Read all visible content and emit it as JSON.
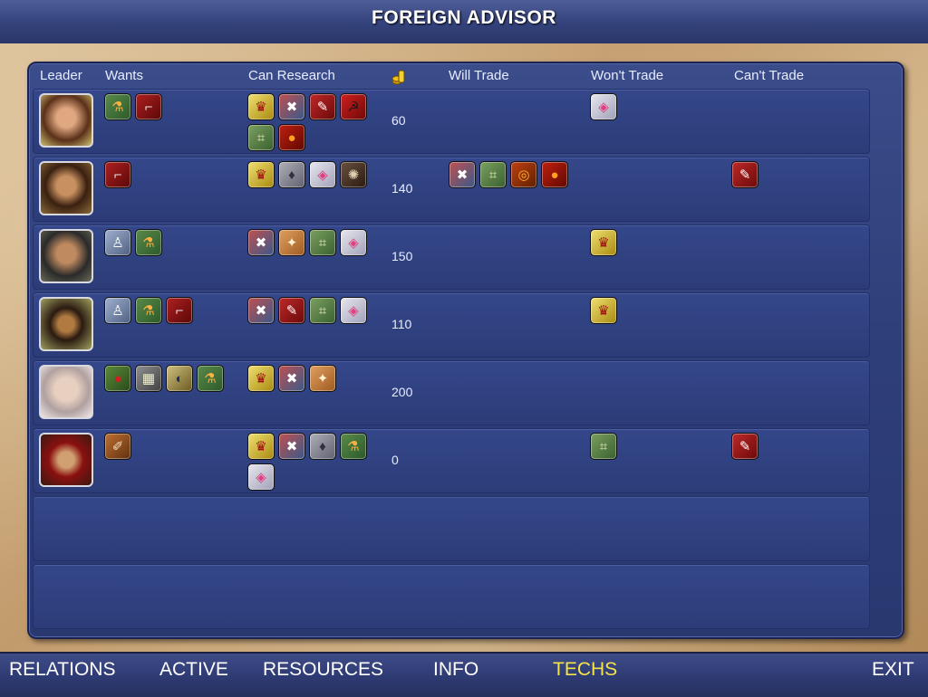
{
  "window": {
    "title": "FOREIGN ADVISOR"
  },
  "columns": {
    "leader": "Leader",
    "wants": "Wants",
    "can_research": "Can Research",
    "will_trade": "Will Trade",
    "wont_trade": "Won't Trade",
    "cant_trade": "Can't Trade"
  },
  "rows": [
    {
      "leader": "leader-1",
      "gold": "60",
      "wants": [
        "chemistry-icon",
        "rifling-icon"
      ],
      "can_research": [
        "monarchy-icon",
        "nationalism-icon",
        "education-icon",
        "communism-icon",
        "cartography-icon",
        "gunpowder-icon"
      ],
      "will_trade": [],
      "wont_trade": [
        "optics-icon"
      ],
      "cant_trade": []
    },
    {
      "leader": "leader-2",
      "gold": "140",
      "wants": [
        "rifling-icon"
      ],
      "can_research": [
        "monarchy-icon",
        "economics-icon",
        "optics-icon",
        "navigation-icon"
      ],
      "will_trade": [
        "nationalism-icon",
        "cartography-icon",
        "metallurgy-icon",
        "gunpowder-icon"
      ],
      "wont_trade": [],
      "cant_trade": [
        "education-icon"
      ]
    },
    {
      "leader": "leader-3",
      "gold": "150",
      "wants": [
        "medicine-icon",
        "chemistry-icon"
      ],
      "can_research": [
        "nationalism-icon",
        "astronomy-icon",
        "cartography-icon",
        "optics-icon"
      ],
      "will_trade": [],
      "wont_trade": [
        "monarchy-icon"
      ],
      "cant_trade": []
    },
    {
      "leader": "leader-4",
      "gold": "110",
      "wants": [
        "medicine-icon",
        "chemistry-icon",
        "rifling-icon"
      ],
      "can_research": [
        "nationalism-icon",
        "education-icon",
        "cartography-icon",
        "optics-icon"
      ],
      "will_trade": [],
      "wont_trade": [
        "monarchy-icon"
      ],
      "cant_trade": []
    },
    {
      "leader": "leader-5",
      "gold": "200",
      "wants": [
        "theory-of-gravity-icon",
        "banking-icon",
        "physics-icon",
        "chemistry-icon"
      ],
      "can_research": [
        "monarchy-icon",
        "nationalism-icon",
        "astronomy-icon"
      ],
      "will_trade": [],
      "wont_trade": [],
      "cant_trade": []
    },
    {
      "leader": "leader-6",
      "gold": "0",
      "wants": [
        "invention-icon"
      ],
      "can_research": [
        "monarchy-icon",
        "nationalism-icon",
        "economics-icon",
        "chemistry-icon",
        "optics-icon"
      ],
      "will_trade": [],
      "wont_trade": [
        "cartography-icon"
      ],
      "cant_trade": [
        "education-icon"
      ]
    }
  ],
  "nav": [
    {
      "label": "RELATIONS",
      "active": false
    },
    {
      "label": "ACTIVE",
      "active": false
    },
    {
      "label": "RESOURCES",
      "active": false
    },
    {
      "label": "INFO",
      "active": false
    },
    {
      "label": "TECHS",
      "active": true
    },
    {
      "label": "EXIT",
      "active": false
    }
  ],
  "colors": {
    "panel": "#2e3e78",
    "active_nav": "#f4e44a",
    "parchment": "#c9ab82"
  }
}
